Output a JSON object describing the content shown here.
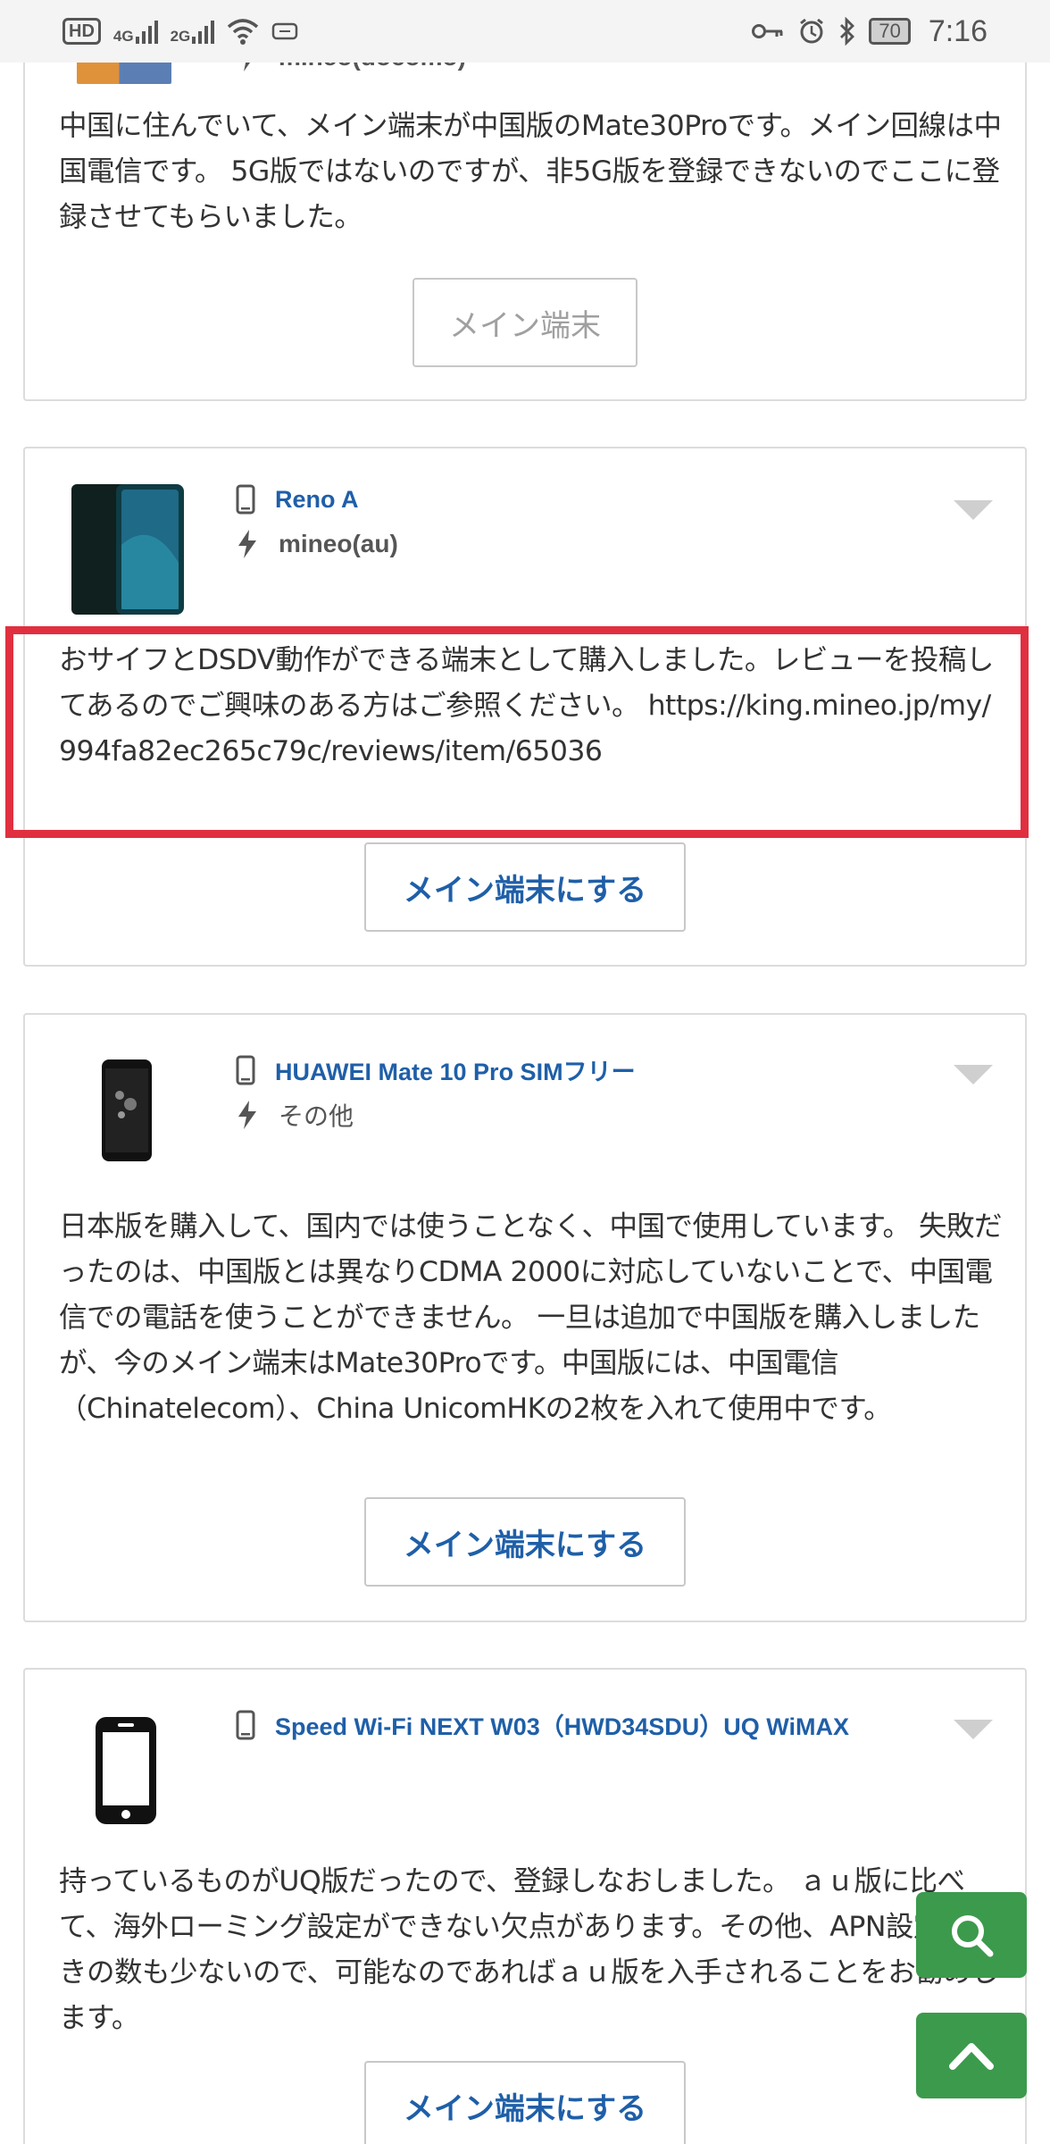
{
  "status_bar": {
    "left_badge": "HD",
    "net1": "4G",
    "net2": "2G",
    "battery": "70",
    "time": "7:16"
  },
  "cards": [
    {
      "carrier": "mineo(docomo)",
      "text": "中国に住んでいて、メイン端末が中国版のMate30Proです。メイン回線は中国電信です。 5G版ではないのですが、非5G版を登録できないのでここに登録させてもらいました。",
      "button": "メイン端末"
    },
    {
      "device": "Reno A",
      "carrier": "mineo(au)",
      "text": "おサイフとDSDV動作ができる端末として購入しました。レビューを投稿してあるのでご興味のある方はご参照ください。 https://king.mineo.jp/my/994fa82ec265c79c/reviews/item/65036",
      "button": "メイン端末にする"
    },
    {
      "device": "HUAWEI Mate 10 Pro SIMフリー",
      "carrier": "その他",
      "text": "日本版を購入して、国内では使うことなく、中国で使用しています。 失敗だったのは、中国版とは異なりCDMA 2000に対応していないことで、中国電信での電話を使うことができません。 一旦は追加で中国版を購入しましたが、今のメイン端末はMate30Proです。中国版には、中国電信（Chinatelecom）、China UnicomHKの2枚を入れて使用中です。",
      "button": "メイン端末にする"
    },
    {
      "device": "Speed Wi-Fi NEXT W03（HWD34SDU）UQ WiMAX",
      "text": "持っているものがUQ版だったので、登録しなおしました。 ａｕ版に比べて、海外ローミング設定ができない欠点があります。その他、APN設定の空きの数も少ないので、可能なのであればａｕ版を入手されることをお勧めします。",
      "button": "メイン端末にする"
    }
  ],
  "colors": {
    "link": "#1f5fa8",
    "highlight": "#e03040",
    "fab": "#3c9a4c"
  },
  "icons": [
    "phone-icon",
    "lightning-icon",
    "chevron-down-icon",
    "search-icon",
    "chevron-up-icon"
  ]
}
